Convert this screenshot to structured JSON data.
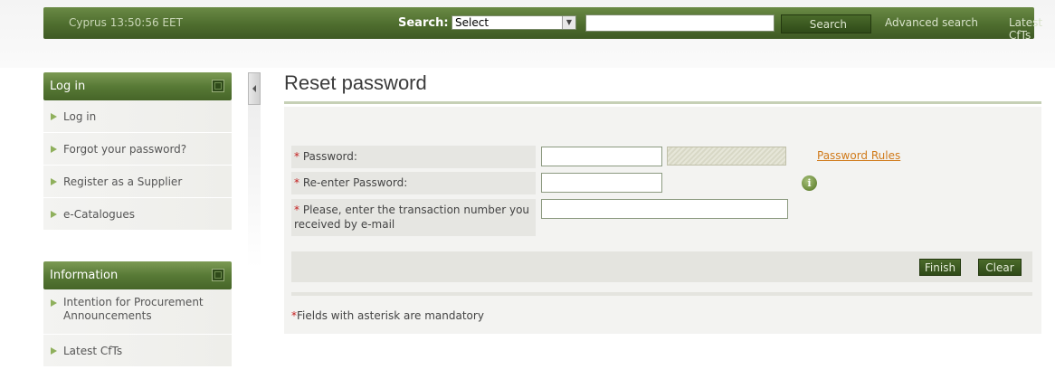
{
  "topbar": {
    "clock": "Cyprus 13:50:56 EET",
    "search_label": "Search:",
    "search_select_value": "Select",
    "search_input_value": "",
    "search_button": "Search",
    "advanced_search": "Advanced search",
    "latest_cfts": "Latest CfTs"
  },
  "sidebar": {
    "login_box": {
      "title": "Log in",
      "items": [
        {
          "label": "Log in"
        },
        {
          "label": "Forgot your password?"
        },
        {
          "label": "Register as a Supplier"
        },
        {
          "label": "e-Catalogues"
        }
      ]
    },
    "info_box": {
      "title": "Information",
      "items": [
        {
          "label": "Intention for Procurement Announcements"
        },
        {
          "label": "Latest CfTs"
        }
      ]
    }
  },
  "main": {
    "title": "Reset password",
    "form": {
      "password_label": "Password:",
      "reenter_label": "Re-enter Password:",
      "transaction_label": "Please, enter the transaction number you received by e-mail",
      "password_value": "",
      "reenter_value": "",
      "transaction_value": "",
      "password_rules": "Password Rules",
      "info_icon": "i",
      "required_marker": "*"
    },
    "finish_button": "Finish",
    "clear_button": "Clear",
    "mandatory_note": "Fields with asterisk are mandatory"
  },
  "colors": {
    "brand_green": "#4e6d2e",
    "required_red": "#c42020",
    "link_orange": "#d07a1a"
  }
}
